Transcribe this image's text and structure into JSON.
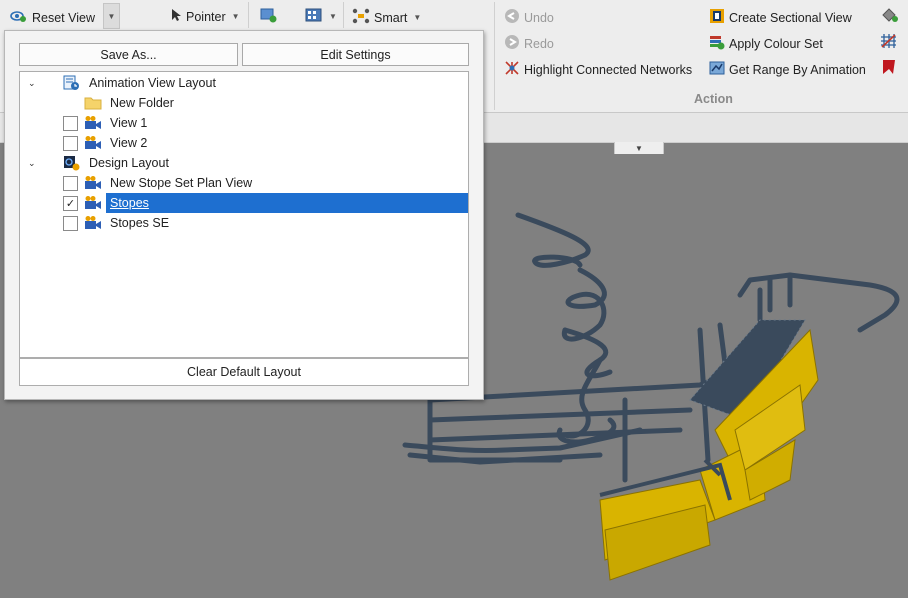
{
  "toolbar": {
    "reset_view_label": "Reset View",
    "pointer_label": "Pointer",
    "smart_label": "Smart"
  },
  "ribbon": {
    "undo_label": "Undo",
    "redo_label": "Redo",
    "highlight_label": "Highlight Connected Networks",
    "create_section_label": "Create Sectional View",
    "apply_colour_label": "Apply Colour Set",
    "get_range_label": "Get Range By Animation",
    "group_label": "Action"
  },
  "popup": {
    "save_as_label": "Save As...",
    "edit_settings_label": "Edit Settings",
    "clear_default_label": "Clear Default Layout",
    "tree": [
      {
        "label": "Animation View Layout",
        "type": "group",
        "expanded": true
      },
      {
        "label": "New Folder",
        "type": "folder"
      },
      {
        "label": "View 1",
        "type": "view",
        "checked": false
      },
      {
        "label": "View 2",
        "type": "view",
        "checked": false
      },
      {
        "label": "Design Layout",
        "type": "group",
        "expanded": true
      },
      {
        "label": "New Stope Set Plan View",
        "type": "view",
        "checked": false
      },
      {
        "label": "Stopes",
        "type": "view",
        "checked": true,
        "selected": true
      },
      {
        "label": "Stopes SE",
        "type": "view",
        "checked": false
      }
    ]
  },
  "colors": {
    "selection": "#1e6fd0",
    "tunnel": "#3a4a5c",
    "stope": "#d9b400",
    "viewport_bg": "#808080"
  }
}
